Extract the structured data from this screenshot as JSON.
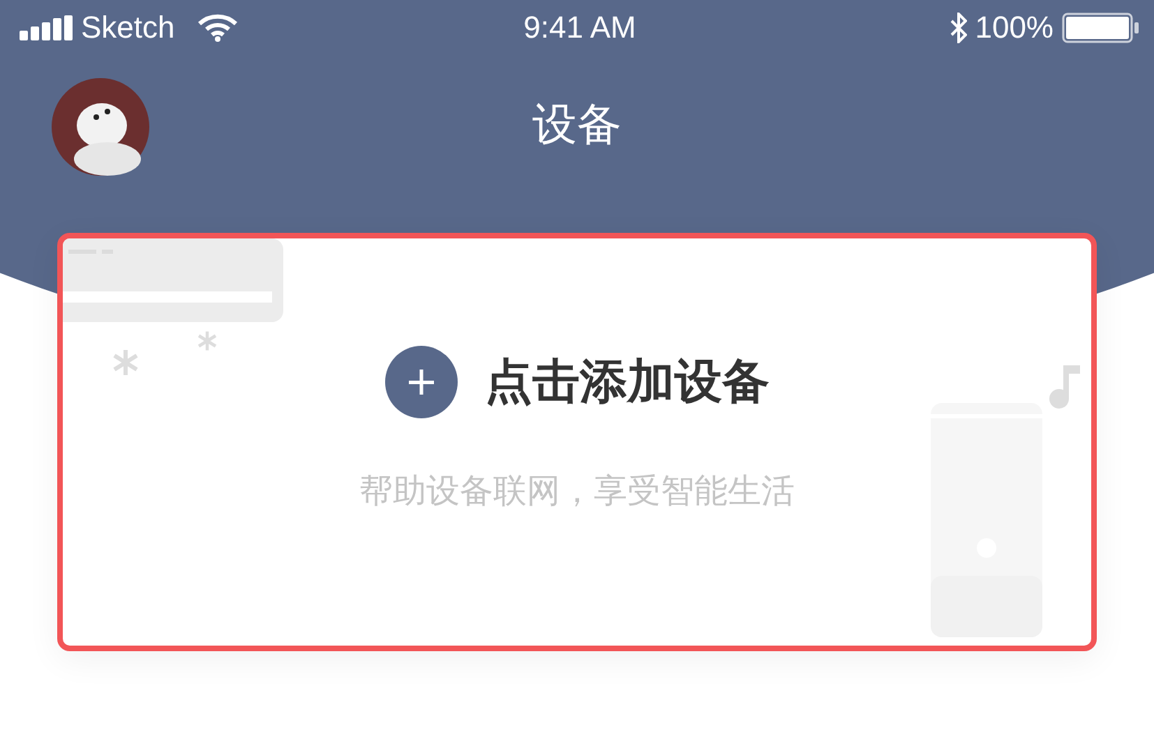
{
  "status_bar": {
    "carrier": "Sketch",
    "time": "9:41 AM",
    "battery": "100%"
  },
  "nav": {
    "title": "设备"
  },
  "add_card": {
    "title": "点击添加设备",
    "subtitle": "帮助设备联网，享受智能生活"
  }
}
